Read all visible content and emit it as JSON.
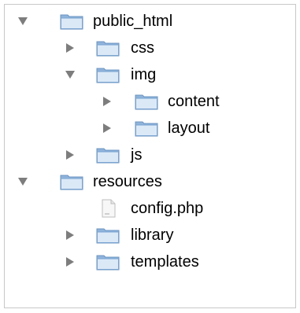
{
  "tree": {
    "items": [
      {
        "label": "public_html",
        "kind": "folder",
        "state": "expanded",
        "icon": "folder-icon"
      },
      {
        "label": "css",
        "kind": "folder",
        "state": "collapsed",
        "icon": "folder-icon"
      },
      {
        "label": "img",
        "kind": "folder",
        "state": "expanded",
        "icon": "folder-icon"
      },
      {
        "label": "content",
        "kind": "folder",
        "state": "collapsed",
        "icon": "folder-icon"
      },
      {
        "label": "layout",
        "kind": "folder",
        "state": "collapsed",
        "icon": "folder-icon"
      },
      {
        "label": "js",
        "kind": "folder",
        "state": "collapsed",
        "icon": "folder-icon"
      },
      {
        "label": "resources",
        "kind": "folder",
        "state": "expanded",
        "icon": "folder-icon"
      },
      {
        "label": "config.php",
        "kind": "file",
        "state": "none",
        "icon": "file-icon"
      },
      {
        "label": "library",
        "kind": "folder",
        "state": "collapsed",
        "icon": "folder-icon"
      },
      {
        "label": "templates",
        "kind": "folder",
        "state": "collapsed",
        "icon": "folder-icon"
      }
    ]
  },
  "colors": {
    "folder_light": "#dbe9f7",
    "folder_dark": "#8fb4dc",
    "disclosure": "#7d7d7d"
  }
}
